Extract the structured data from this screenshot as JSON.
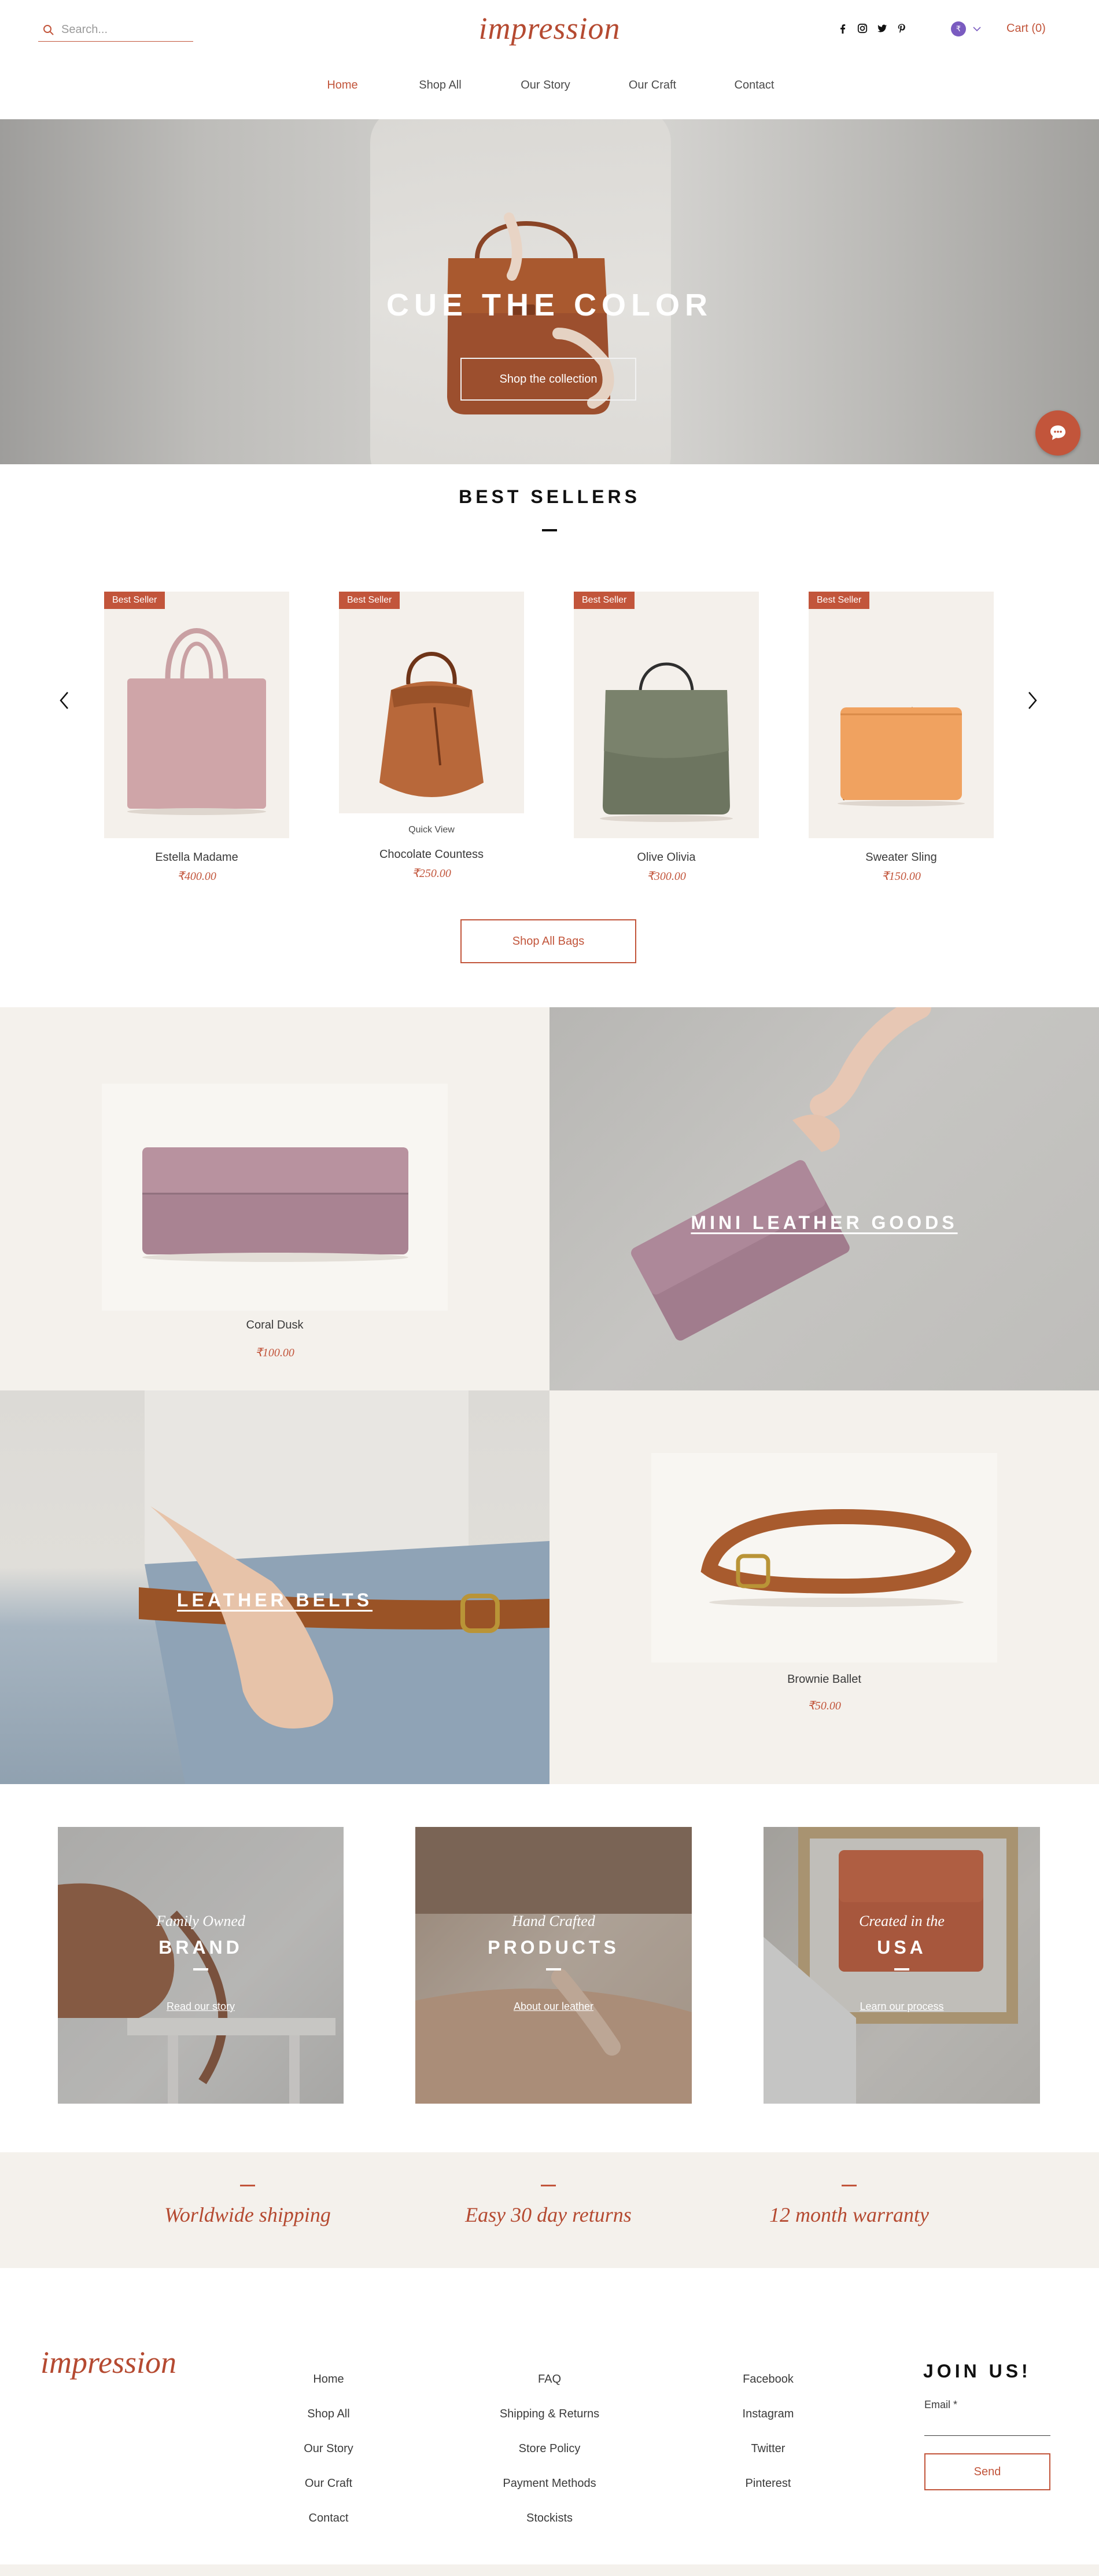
{
  "header": {
    "search_placeholder": "Search...",
    "logo": "impression",
    "socials": [
      "facebook-icon",
      "instagram-icon",
      "twitter-icon",
      "pinterest-icon"
    ],
    "currency_symbol": "₹",
    "cart_label": "Cart (0)"
  },
  "nav": {
    "items": [
      {
        "label": "Home",
        "active": true
      },
      {
        "label": "Shop All",
        "active": false
      },
      {
        "label": "Our Story",
        "active": false
      },
      {
        "label": "Our Craft",
        "active": false
      },
      {
        "label": "Contact",
        "active": false
      }
    ]
  },
  "hero": {
    "title": "CUE THE COLOR",
    "button": "Shop the collection"
  },
  "best_sellers": {
    "title": "BEST SELLERS",
    "products": [
      {
        "badge": "Best Seller",
        "name": "Estella Madame",
        "price": "₹400.00"
      },
      {
        "badge": "Best Seller",
        "name": "Chocolate Countess",
        "price": "₹250.00",
        "quick_view": "Quick View"
      },
      {
        "badge": "Best Seller",
        "name": "Olive Olivia",
        "price": "₹300.00"
      },
      {
        "badge": "Best Seller",
        "name": "Sweater Sling",
        "price": "₹150.00"
      }
    ],
    "button": "Shop All Bags"
  },
  "tiles": {
    "coral": {
      "name": "Coral Dusk",
      "price": "₹100.00"
    },
    "mini_leather": "MINI LEATHER GOODS",
    "leather_belts": "LEATHER BELTS",
    "brownie": {
      "name": "Brownie Ballet",
      "price": "₹50.00"
    }
  },
  "story_cards": [
    {
      "kicker": "Family Owned",
      "heading": "BRAND",
      "link": "Read our story"
    },
    {
      "kicker": "Hand Crafted",
      "heading": "PRODUCTS",
      "link": "About our leather"
    },
    {
      "kicker": "Created in the",
      "heading": "USA",
      "link": "Learn our process"
    }
  ],
  "perks": [
    "Worldwide shipping",
    "Easy 30 day returns",
    "12 month warranty"
  ],
  "footer": {
    "logo": "impression",
    "col1": [
      "Home",
      "Shop All",
      "Our Story",
      "Our Craft",
      "Contact"
    ],
    "col2": [
      "FAQ",
      "Shipping & Returns",
      "Store Policy",
      "Payment Methods",
      "Stockists"
    ],
    "col3": [
      "Facebook",
      "Instagram",
      "Twitter",
      "Pinterest"
    ],
    "join_title": "JOIN US!",
    "email_label": "Email *",
    "send": "Send"
  },
  "colors": {
    "accent": "#c2553b",
    "logo": "#b54a31",
    "beige": "#f4f1ec",
    "currency_dot": "#7a5bc0"
  }
}
